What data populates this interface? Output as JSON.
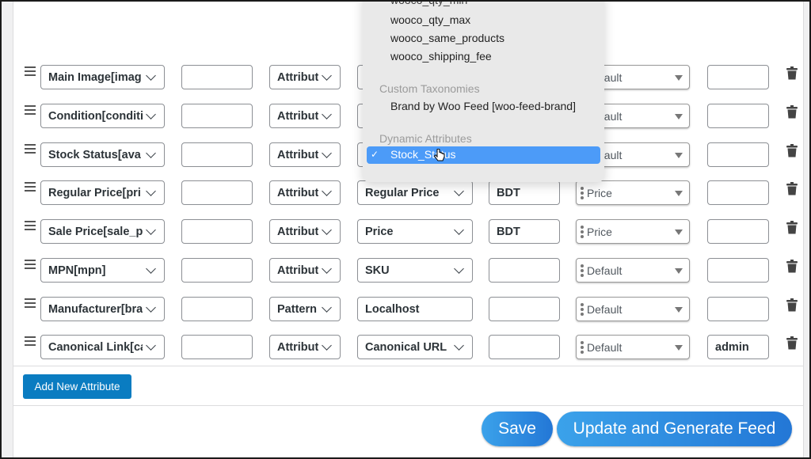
{
  "rows": [
    {
      "attribute": "Main Image[imag",
      "prefix": "",
      "type": "Attribut",
      "value": "",
      "value_is_select": true,
      "suffix": "",
      "output": "Default",
      "command": ""
    },
    {
      "attribute": "Condition[conditi",
      "prefix": "",
      "type": "Attribut",
      "value": "",
      "value_is_select": true,
      "suffix": "",
      "output": "Default",
      "command": ""
    },
    {
      "attribute": "Stock Status[ava",
      "prefix": "",
      "type": "Attribut",
      "value": "",
      "value_is_select": true,
      "suffix": "",
      "output": "Default",
      "command": ""
    },
    {
      "attribute": "Regular Price[pri",
      "prefix": "",
      "type": "Attribut",
      "value": "Regular Price",
      "value_is_select": true,
      "suffix": "BDT",
      "output": "Price",
      "command": ""
    },
    {
      "attribute": "Sale Price[sale_p",
      "prefix": "",
      "type": "Attribut",
      "value": "Price",
      "value_is_select": true,
      "suffix": "BDT",
      "output": "Price",
      "command": ""
    },
    {
      "attribute": "MPN[mpn]",
      "prefix": "",
      "type": "Attribut",
      "value": "SKU",
      "value_is_select": true,
      "suffix": "",
      "output": "Default",
      "command": ""
    },
    {
      "attribute": "Manufacturer[bra",
      "prefix": "",
      "type": "Pattern",
      "value": "Localhost",
      "value_is_select": false,
      "suffix": "",
      "output": "Default",
      "command": ""
    },
    {
      "attribute": "Canonical Link[ca",
      "prefix": "",
      "type": "Attribut",
      "value": "Canonical URL",
      "value_is_select": true,
      "suffix": "",
      "output": "Default",
      "command": "admin"
    }
  ],
  "dropdown": {
    "partial_option": "wooco_qty_min",
    "options": [
      "wooco_qty_max",
      "wooco_same_products",
      "wooco_shipping_fee"
    ],
    "group_custom_taxonomies": "Custom Taxonomies",
    "taxonomy_options": [
      "Brand by Woo Feed [woo-feed-brand]"
    ],
    "group_dynamic_attributes": "Dynamic Attributes",
    "selected_option": "Stock_Status",
    "check_mark": "✓"
  },
  "buttons": {
    "add_new_attribute": "Add New Attribute",
    "save": "Save",
    "update_generate": "Update and Generate Feed"
  },
  "colors": {
    "primary_button": "#0a7cc1",
    "pill_button": "#2a87dd",
    "highlight": "#4c9bf8"
  }
}
